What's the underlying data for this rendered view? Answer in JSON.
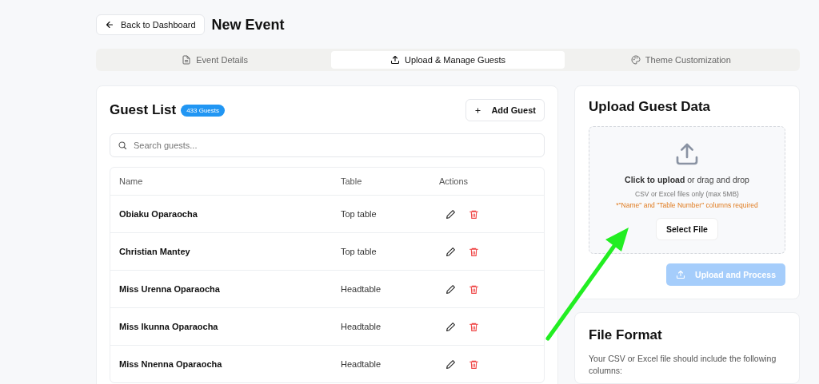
{
  "header": {
    "back_button": "Back to Dashboard",
    "title": "New Event"
  },
  "tabs": [
    {
      "label": "Event Details",
      "selected": false
    },
    {
      "label": "Upload & Manage Guests",
      "selected": true
    },
    {
      "label": "Theme Customization",
      "selected": false
    }
  ],
  "guest_list": {
    "title": "Guest List",
    "count_badge": "433 Guests",
    "add_button": "Add Guest",
    "search": {
      "placeholder": "Search guests..."
    },
    "columns": [
      "Name",
      "Table",
      "Actions"
    ],
    "rows": [
      {
        "name": "Obiaku Oparaocha",
        "table": "Top table"
      },
      {
        "name": "Christian Mantey",
        "table": "Top table"
      },
      {
        "name": "Miss Urenna Oparaocha",
        "table": "Headtable"
      },
      {
        "name": "Miss Ikunna Oparaocha",
        "table": "Headtable"
      },
      {
        "name": "Miss Nnenna Oparaocha",
        "table": "Headtable"
      }
    ]
  },
  "upload": {
    "title": "Upload Guest Data",
    "prompt": "**Click to upload** or drag and drop",
    "hint": "CSV or Excel files only (max 5MB)",
    "requirement": "*\"Name\" and \"Table Number\" columns required",
    "select_button": "Select File",
    "process_button": {
      "label": "Upload and Process",
      "disabled": true
    }
  },
  "file_format": {
    "title": "File Format",
    "description": "Your CSV or Excel file should include the following columns:"
  }
}
